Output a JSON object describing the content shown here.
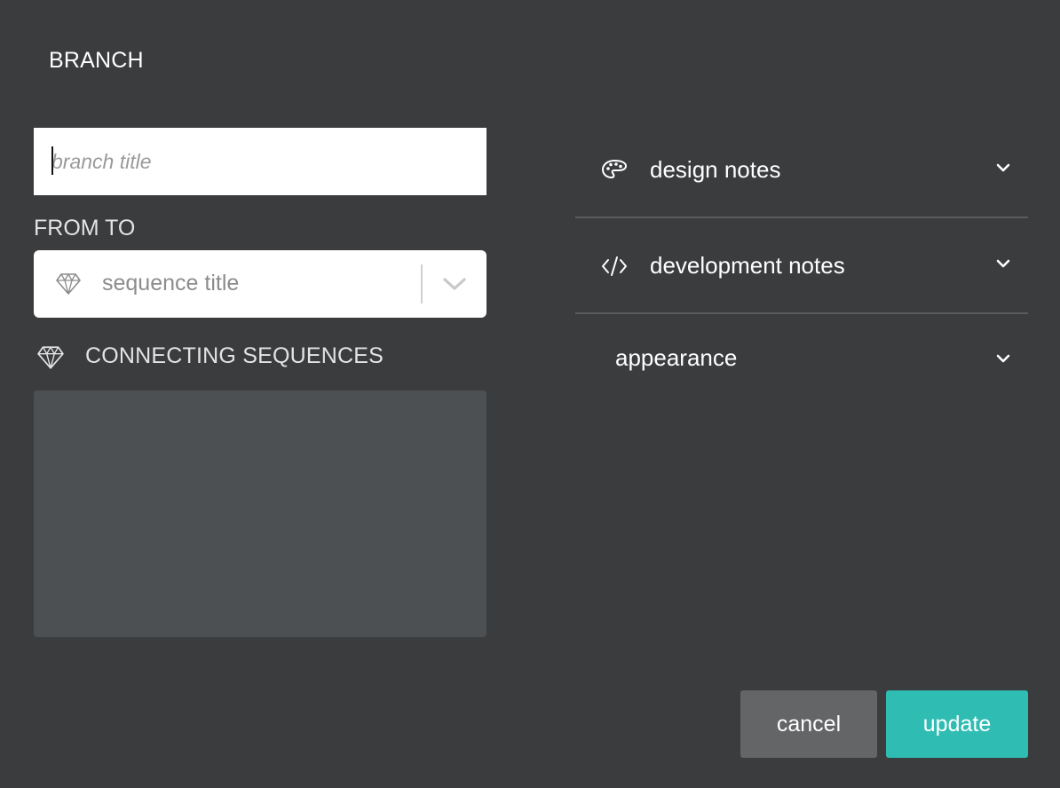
{
  "header": {
    "title": "BRANCH"
  },
  "branch_title_input": {
    "placeholder": "branch title",
    "value": ""
  },
  "from_to": {
    "label": "FROM TO",
    "select": {
      "icon": "diamond-icon",
      "selected_label": "sequence title"
    }
  },
  "connecting_sequences": {
    "icon": "diamond-icon",
    "label": "CONNECTING SEQUENCES",
    "items": []
  },
  "accordion": [
    {
      "icon": "palette-icon",
      "label": "design notes"
    },
    {
      "icon": "code-icon",
      "label": "development notes"
    },
    {
      "icon": "",
      "label": "appearance"
    }
  ],
  "buttons": {
    "cancel_label": "cancel",
    "update_label": "update"
  },
  "colors": {
    "background": "#3b3c3e",
    "accent": "#2fbdb3",
    "cancel_button": "#636566",
    "panel": "#4c5052"
  }
}
